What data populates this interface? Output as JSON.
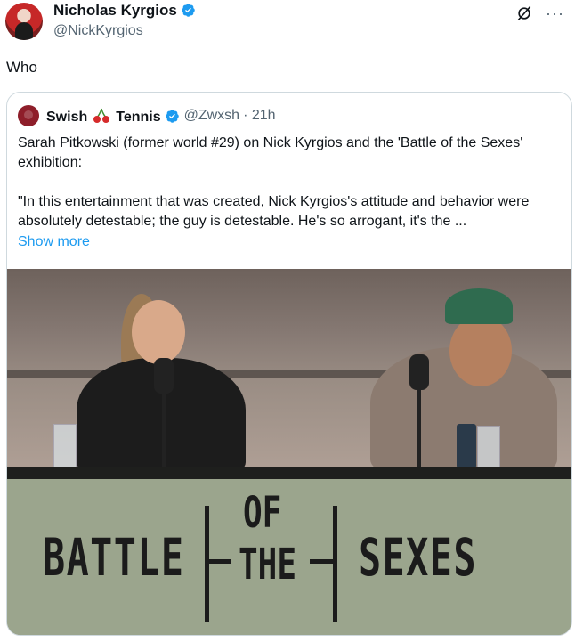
{
  "post": {
    "author_name": "Nicholas Kyrgios",
    "handle": "@NickKyrgios",
    "text": "Who"
  },
  "quote": {
    "name_left": "Swish",
    "name_right": "Tennis",
    "handle": "@Zwxsh",
    "time": "· 21h",
    "paragraph1": "Sarah Pitkowski (former world #29) on Nick Kyrgios and the 'Battle of the Sexes' exhibition:",
    "paragraph2": "\"In this entertainment that was created, Nick Kyrgios's attitude and behavior were absolutely detestable; the guy is detestable. He's so arrogant, it's the ...",
    "show_more": "Show more"
  },
  "media": {
    "banner_battle": "BATTLE",
    "banner_of": "OF",
    "banner_the": "THE",
    "banner_sexes": "SEXES"
  },
  "colors": {
    "verified": "#1d9bf0",
    "link": "#1d9bf0",
    "muted": "#536471",
    "banner": "#9ba58d"
  },
  "icons": [
    "verified-badge-icon",
    "grok-icon",
    "more-options-icon",
    "cherry-icon"
  ]
}
